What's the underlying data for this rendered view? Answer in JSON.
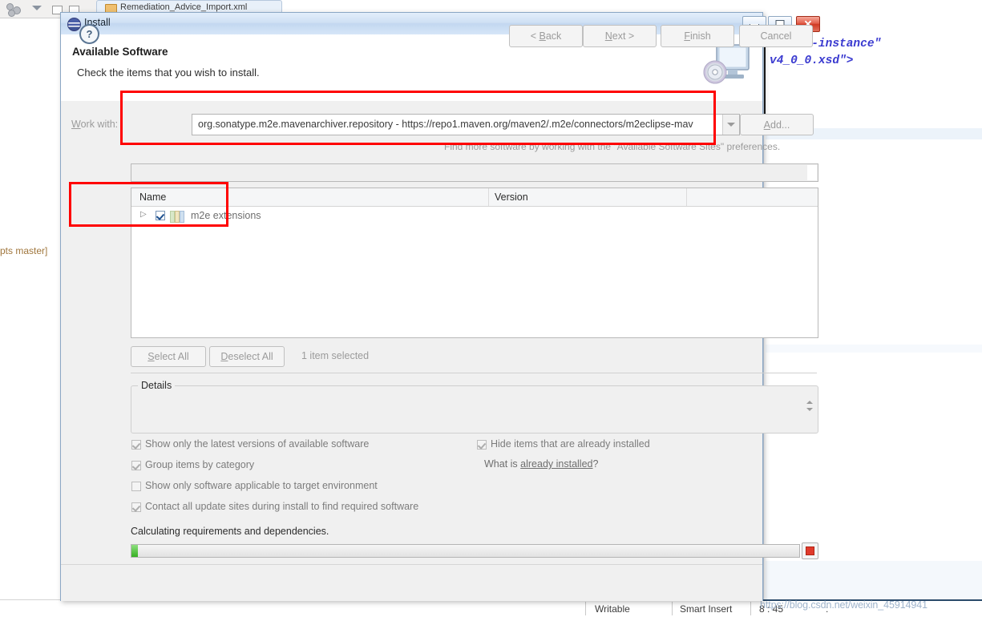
{
  "background": {
    "editor_tab_label": "Remediation_Advice_Import.xml",
    "folder_icon": "xml-file-icon",
    "left_text": "pts master]",
    "code_lines": [
      {
        "text": "Schema-instance\"",
        "color": "#3b3bd0"
      },
      {
        "text": "v4_0_0.xsd\">",
        "color": "#3b3bd0",
        "tail": ">",
        "tail_color": "#1f7a1f"
      }
    ],
    "statusbar": {
      "writable": "Writable",
      "insert_mode": "Smart Insert",
      "position": "8 : 45",
      "extra": ":"
    },
    "watermark": "https://blog.csdn.net/weixin_45914941"
  },
  "dialog": {
    "title": "Install",
    "title_icon": "eclipse-icon",
    "window_buttons": {
      "minimize": "minimize-icon",
      "maximize": "maximize-icon",
      "close": "close-icon"
    },
    "header": {
      "title": "Available Software",
      "subtitle": "Check the items that you wish to install.",
      "banner_icon": "install-monitor-disc-icon"
    },
    "work_with": {
      "label": "Work with",
      "label_mnemonic": "W",
      "colon": ":",
      "value": "org.sonatype.m2e.mavenarchiver.repository - https://repo1.maven.org/maven2/.m2e/connectors/m2eclipse-mav",
      "dropdown_icon": "chevron-down-icon",
      "add_button": "Add...",
      "add_button_mnemonic": "A",
      "hint": "Find more software by working with the \"Available Software Sites\" preferences."
    },
    "filter": {
      "placeholder": "",
      "value": ""
    },
    "table": {
      "columns": [
        "Name",
        "Version"
      ],
      "rows": [
        {
          "expand_icon": "chevron-right-icon",
          "checked": true,
          "icon": "category-icon",
          "name": "m2e extensions",
          "version": ""
        }
      ]
    },
    "selection_bar": {
      "select_all": "Select All",
      "select_all_mnemonic": "S",
      "deselect_all": "Deselect All",
      "deselect_all_mnemonic": "D",
      "count": "1 item selected"
    },
    "details": {
      "group_title": "Details",
      "text": "",
      "spinner_icon": "spinner-updown-icon"
    },
    "options_left": [
      {
        "label": "Show only the latest versions of available software",
        "mnemonic": "l",
        "checked": true,
        "disabled": true
      },
      {
        "label": "Group items by category",
        "mnemonic": "G",
        "checked": true,
        "disabled": true
      },
      {
        "label": "Show only software applicable to target environment",
        "mnemonic": "",
        "checked": false,
        "disabled": true
      },
      {
        "label": "Contact all update sites during install to find required software",
        "mnemonic": "C",
        "checked": true,
        "disabled": true
      }
    ],
    "options_right": [
      {
        "label": "Hide items that are already installed",
        "mnemonic": "H",
        "checked": true,
        "disabled": true
      }
    ],
    "what_is": {
      "prefix": "What is ",
      "link": "already installed",
      "suffix": "?"
    },
    "progress": {
      "status_text": "Calculating requirements and dependencies.",
      "percent": 1,
      "fill_color": "#36b022",
      "stop_button": "stop-icon"
    },
    "footer": {
      "help_icon": "help-question-icon",
      "buttons": [
        {
          "label": "< Back",
          "mnemonic": "B",
          "disabled": true
        },
        {
          "label": "Next >",
          "mnemonic": "N",
          "disabled": true
        },
        {
          "label": "Finish",
          "mnemonic": "F",
          "disabled": true
        },
        {
          "label": "Cancel",
          "mnemonic": "",
          "disabled": true
        }
      ]
    }
  },
  "annotations": {
    "highlight_color": "#ff0000",
    "boxes": [
      "work-with-row",
      "m2e-extensions-row"
    ]
  }
}
